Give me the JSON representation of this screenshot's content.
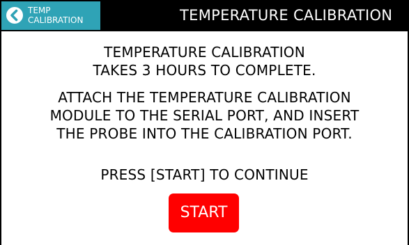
{
  "header": {
    "back_button": {
      "line1": "TEMP",
      "line2": "CALIBRATION",
      "icon": "chevron-left-icon"
    },
    "title": "TEMPERATURE CALIBRATION"
  },
  "main": {
    "info_line1": "TEMPERATURE CALIBRATION",
    "info_line2": "TAKES 3 HOURS TO COMPLETE.",
    "instruction_line1": "ATTACH THE TEMPERATURE CALIBRATION",
    "instruction_line2": "MODULE TO THE SERIAL PORT, AND INSERT",
    "instruction_line3": "THE PROBE INTO THE CALIBRATION PORT.",
    "prompt": "PRESS [START] TO CONTINUE",
    "start_label": "START"
  },
  "colors": {
    "header_bg": "#000000",
    "back_button_bg": "#2fa3b6",
    "start_button_bg": "#ff0000",
    "text": "#000000",
    "background": "#ffffff"
  }
}
